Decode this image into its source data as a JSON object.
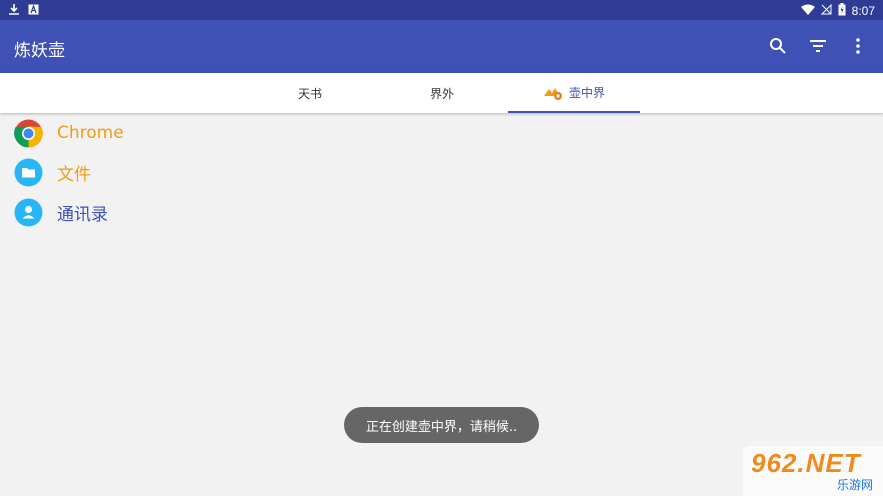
{
  "status_bar": {
    "time": "8:07",
    "icons": [
      "download-icon",
      "font-icon",
      "wifi-icon",
      "no-signal-icon",
      "battery-icon"
    ]
  },
  "app_bar": {
    "title": "炼妖壶",
    "actions": [
      "search-icon",
      "filter-icon",
      "more-vert-icon"
    ]
  },
  "tabs": [
    {
      "label": "天书",
      "active": false
    },
    {
      "label": "界外",
      "active": false
    },
    {
      "label": "壶中界",
      "active": true,
      "icon": "island-icon"
    }
  ],
  "apps": [
    {
      "name": "Chrome",
      "icon": "chrome-icon",
      "color": "#f39c12"
    },
    {
      "name": "文件",
      "icon": "folder-icon",
      "color": "#f39c12"
    },
    {
      "name": "通讯录",
      "icon": "contacts-icon",
      "color": "#3f51b5"
    }
  ],
  "toast": {
    "text": "正在创建壶中界，请稍候.."
  },
  "watermark": {
    "brand": "962.NET",
    "sub": "乐游网"
  },
  "colors": {
    "primary": "#3f51b5",
    "primary_dark": "#2e3c96",
    "accent_orange": "#f39c12",
    "toast_bg": "#666666"
  }
}
